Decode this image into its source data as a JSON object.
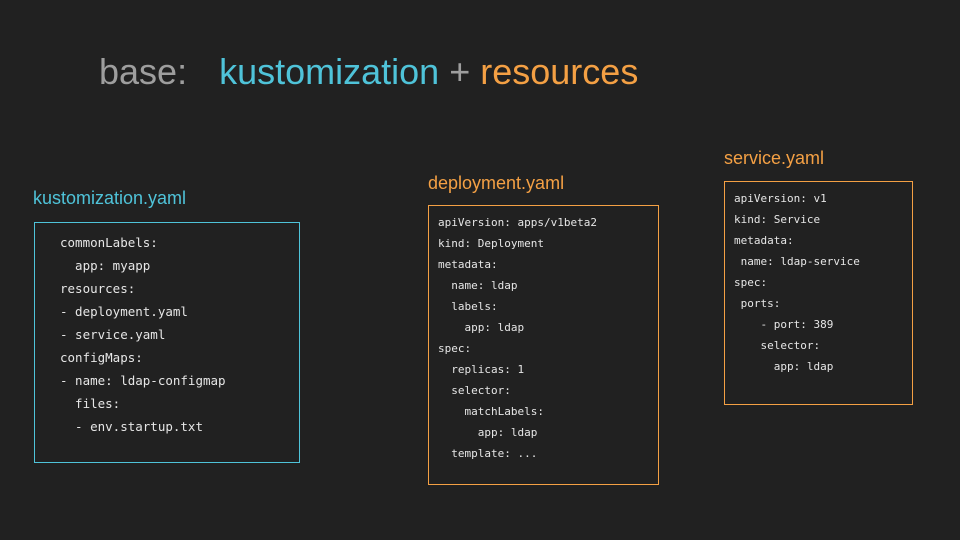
{
  "title": {
    "base": "base:",
    "kustomization": "kustomization",
    "plus": "+",
    "resources": "resources"
  },
  "colors": {
    "background": "#212121",
    "muted": "#9e9e9e",
    "cyan": "#4fc3d9",
    "orange": "#f4a044",
    "code_text": "#e6e6e6"
  },
  "kustomization": {
    "filename": "kustomization.yaml",
    "lines": [
      "commonLabels:",
      "  app: myapp",
      "resources:",
      "- deployment.yaml",
      "- service.yaml",
      "configMaps:",
      "- name: ldap-configmap",
      "  files:",
      "  - env.startup.txt"
    ]
  },
  "deployment": {
    "filename": "deployment.yaml",
    "lines": [
      "apiVersion: apps/v1beta2",
      "kind: Deployment",
      "metadata:",
      "  name: ldap",
      "  labels:",
      "    app: ldap",
      "spec:",
      "  replicas: 1",
      "  selector:",
      "    matchLabels:",
      "      app: ldap",
      "  template: ..."
    ]
  },
  "service": {
    "filename": "service.yaml",
    "lines": [
      "apiVersion: v1",
      "kind: Service",
      "metadata:",
      " name: ldap-service",
      "spec:",
      " ports:",
      "    - port: 389",
      "    selector:",
      "      app: ldap"
    ]
  }
}
